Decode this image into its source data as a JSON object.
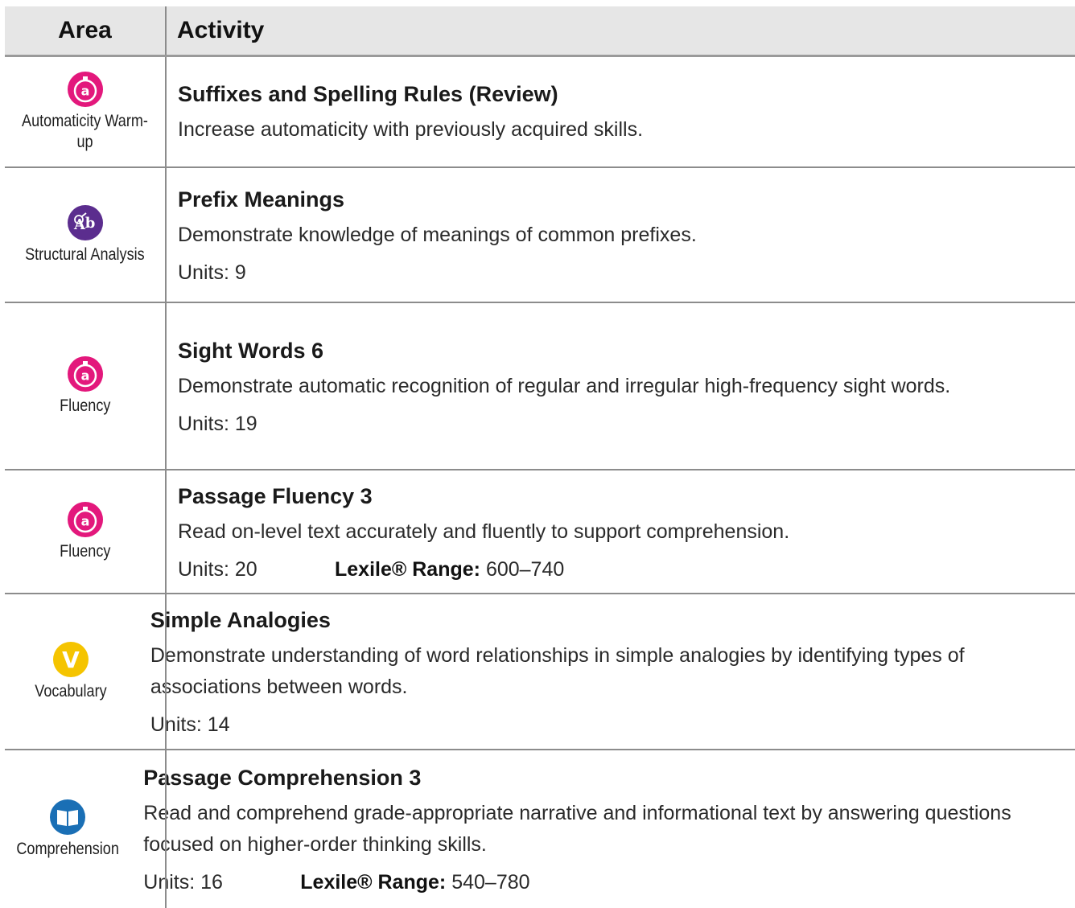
{
  "header": {
    "area": "Area",
    "activity": "Activity"
  },
  "rows": [
    {
      "icon": "automaticity-icon",
      "icon_color": "#e3187c",
      "area": "Automaticity Warm-up",
      "title": "Suffixes and Spelling Rules (Review)",
      "desc": "Increase automaticity with previously acquired skills.",
      "units": "",
      "lexile_label": "",
      "lexile_value": ""
    },
    {
      "icon": "structural-analysis-icon",
      "icon_color": "#5b2d8e",
      "area": "Structural Analysis",
      "title": "Prefix Meanings",
      "desc": "Demonstrate knowledge of meanings of common prefixes.",
      "units": "Units: 9",
      "lexile_label": "",
      "lexile_value": ""
    },
    {
      "icon": "fluency-icon",
      "icon_color": "#e3187c",
      "area": "Fluency",
      "title": "Sight Words 6",
      "desc": "Demonstrate automatic recognition of regular and irregular high-frequency sight words.",
      "units": "Units: 19",
      "lexile_label": "",
      "lexile_value": ""
    },
    {
      "icon": "fluency-icon",
      "icon_color": "#e3187c",
      "area": "Fluency",
      "title": "Passage Fluency 3",
      "desc": "Read on-level text accurately and fluently to support comprehension.",
      "units": "Units: 20",
      "lexile_label": "Lexile® Range:",
      "lexile_value": "600–740"
    },
    {
      "icon": "vocabulary-icon",
      "icon_color": "#f5c400",
      "area": "Vocabulary",
      "title": "Simple Analogies",
      "desc": "Demonstrate understanding of word relationships in simple analogies by identifying types of associations between words.",
      "units": "Units: 14",
      "lexile_label": "",
      "lexile_value": ""
    },
    {
      "icon": "comprehension-icon",
      "icon_color": "#1a6fb5",
      "area": "Comprehension",
      "title": "Passage Comprehension 3",
      "desc": "Read and comprehend grade-appropriate narrative and informational text by answering questions focused on higher-order thinking skills.",
      "units": "Units: 16",
      "lexile_label": "Lexile® Range:",
      "lexile_value": "540–780"
    }
  ]
}
